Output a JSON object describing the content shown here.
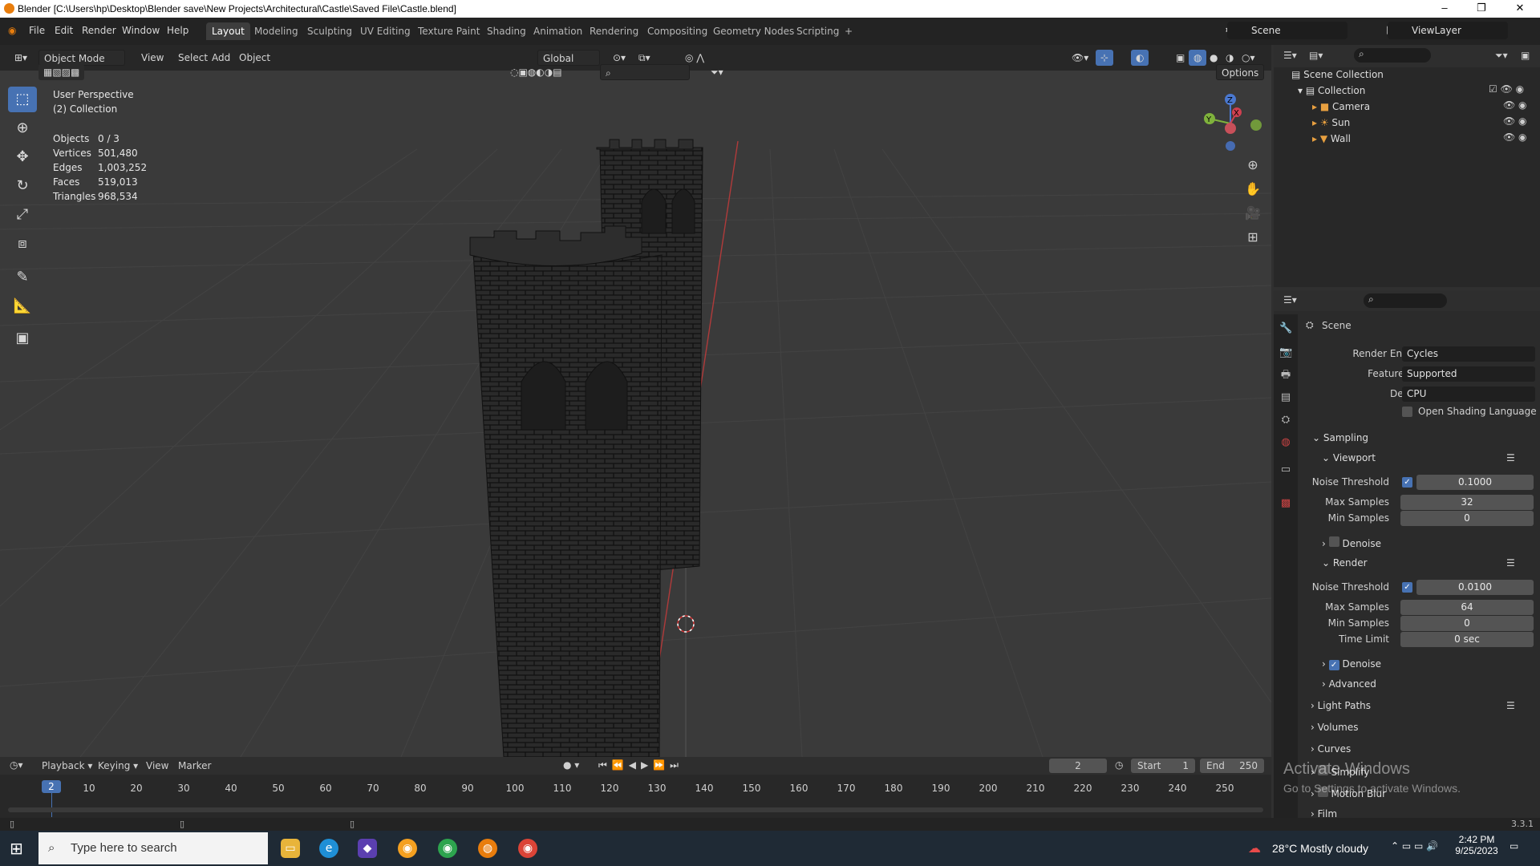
{
  "window": {
    "title": "Blender [C:\\Users\\hp\\Desktop\\Blender save\\New Projects\\Architectural\\Castle\\Saved File\\Castle.blend]",
    "minimize": "–",
    "maximize": "❐",
    "close": "✕"
  },
  "menu": [
    "File",
    "Edit",
    "Render",
    "Window",
    "Help"
  ],
  "workspaces": [
    "Layout",
    "Modeling",
    "Sculpting",
    "UV Editing",
    "Texture Paint",
    "Shading",
    "Animation",
    "Rendering",
    "Compositing",
    "Geometry Nodes",
    "Scripting",
    "+"
  ],
  "scene_field": "Scene",
  "view_layer_field": "ViewLayer",
  "viewport": {
    "mode": "Object Mode",
    "menus": [
      "View",
      "Select",
      "Add",
      "Object"
    ],
    "transform": "Global",
    "options": "Options",
    "perspective": "User Perspective",
    "collection": "(2) Collection",
    "stats": [
      {
        "label": "Objects",
        "value": "0 / 3"
      },
      {
        "label": "Vertices",
        "value": "501,480"
      },
      {
        "label": "Edges",
        "value": "1,003,252"
      },
      {
        "label": "Faces",
        "value": "519,013"
      },
      {
        "label": "Triangles",
        "value": "968,534"
      }
    ],
    "gizmo": {
      "x": "X",
      "y": "Y",
      "z": "Z"
    }
  },
  "outliner": {
    "root": "Scene Collection",
    "collection": "Collection",
    "items": [
      "Camera",
      "Sun",
      "Wall"
    ]
  },
  "properties": {
    "header": "Scene",
    "render_engine_label": "Render Engine",
    "render_engine": "Cycles",
    "feature_set_label": "Feature Set",
    "feature_set": "Supported",
    "device_label": "Device",
    "device": "CPU",
    "osl": "Open Shading Language",
    "sampling": "Sampling",
    "viewport": "Viewport",
    "vp_noise_label": "Noise Threshold",
    "vp_noise": "0.1000",
    "vp_max_label": "Max Samples",
    "vp_max": "32",
    "vp_min_label": "Min Samples",
    "vp_min": "0",
    "denoise": "Denoise",
    "render": "Render",
    "r_noise_label": "Noise Threshold",
    "r_noise": "0.0100",
    "r_max_label": "Max Samples",
    "r_max": "64",
    "r_min_label": "Min Samples",
    "r_min": "0",
    "r_time_label": "Time Limit",
    "r_time": "0 sec",
    "r_denoise": "Denoise",
    "advanced": "Advanced",
    "light_paths": "Light Paths",
    "volumes": "Volumes",
    "curves": "Curves",
    "simplify": "Simplify",
    "motion_blur": "Motion Blur",
    "film": "Film"
  },
  "timeline": {
    "menus": [
      "Playback",
      "Keying",
      "View",
      "Marker"
    ],
    "current_frame": "2",
    "start_label": "Start",
    "start": "1",
    "end_label": "End",
    "end": "250",
    "ticks": [
      "10",
      "20",
      "30",
      "40",
      "50",
      "60",
      "70",
      "80",
      "90",
      "100",
      "110",
      "120",
      "130",
      "140",
      "150",
      "160",
      "170",
      "180",
      "190",
      "200",
      "210",
      "220",
      "230",
      "240",
      "250"
    ],
    "playhead": "2"
  },
  "activate": {
    "title": "Activate Windows",
    "sub": "Go to Settings to activate Windows."
  },
  "version": "3.3.1",
  "taskbar": {
    "search_placeholder": "Type here to search",
    "weather": "28°C  Mostly cloudy",
    "time": "2:42 PM",
    "date": "9/25/2023"
  },
  "colors": {
    "accent": "#4772b3",
    "bg": "#303030",
    "header": "#232323"
  }
}
